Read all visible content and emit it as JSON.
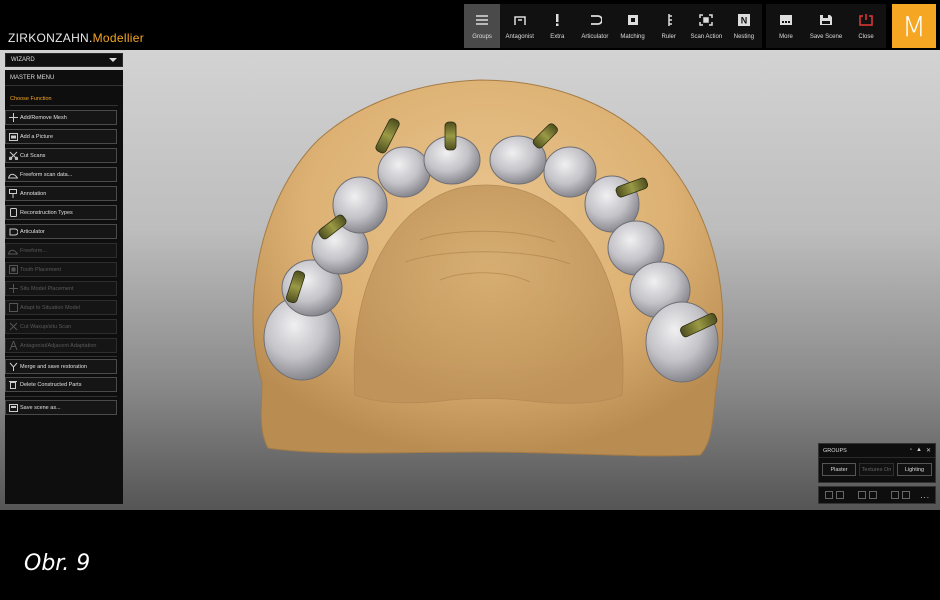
{
  "app": {
    "brand_main": "ZIRKONZAHN.",
    "brand_accent": "Modellier",
    "logo_letter": "M"
  },
  "toolbar": [
    {
      "label": "Groups",
      "icon": "groups-icon",
      "active": true
    },
    {
      "label": "Antagonist",
      "icon": "antagonist-icon"
    },
    {
      "label": "Extra",
      "icon": "extra-icon"
    },
    {
      "label": "Articulator",
      "icon": "articulator-icon"
    },
    {
      "label": "Matching",
      "icon": "matching-icon"
    },
    {
      "label": "Ruler",
      "icon": "ruler-icon"
    },
    {
      "label": "Scan Action",
      "icon": "scan-action-icon"
    },
    {
      "label": "Nesting",
      "icon": "nesting-icon"
    }
  ],
  "toolbar_right": [
    {
      "label": "More",
      "icon": "more-icon"
    },
    {
      "label": "Save Scene",
      "icon": "save-icon"
    },
    {
      "label": "Close",
      "icon": "close-icon"
    }
  ],
  "wizard": {
    "label": "WIZARD"
  },
  "panel": {
    "master_menu": "MASTER MENU",
    "choose_function": "Choose Function",
    "functions": [
      {
        "label": "Add/Remove Mesh",
        "icon": "add-remove-mesh-icon",
        "enabled": true
      },
      {
        "label": "Add a Picture",
        "icon": "picture-icon",
        "enabled": true
      },
      {
        "label": "Cut Scans",
        "icon": "scissors-icon",
        "enabled": true
      },
      {
        "label": "Freeform scan data...",
        "icon": "freeform-icon",
        "enabled": true
      },
      {
        "label": "Annotation",
        "icon": "annotation-icon",
        "enabled": true
      },
      {
        "label": "Reconstruction Types",
        "icon": "reconstruction-icon",
        "enabled": true
      },
      {
        "label": "Articulator",
        "icon": "articulator-icon",
        "enabled": true
      },
      {
        "label": "Freeform...",
        "icon": "freeform-icon",
        "enabled": false
      },
      {
        "label": "Tooth Placement",
        "icon": "tooth-placement-icon",
        "enabled": false
      },
      {
        "label": "Situ Model Placement",
        "icon": "move-icon",
        "enabled": false
      },
      {
        "label": "Adapt to Situation Model",
        "icon": "adapt-icon",
        "enabled": false
      },
      {
        "label": "Cut Waxup/situ Scan",
        "icon": "scissors-icon",
        "enabled": false
      },
      {
        "label": "Antagonist/Adjacent Adaptation",
        "icon": "antagonist-adapt-icon",
        "enabled": false
      }
    ],
    "merge": {
      "label": "Merge and save restoration",
      "icon": "merge-icon"
    },
    "delete": {
      "label": "Delete Constructed Parts",
      "icon": "trash-icon"
    },
    "save": {
      "label": "Save scene as...",
      "icon": "save-scene-icon"
    }
  },
  "groups_panel": {
    "title": "GROUPS",
    "buttons": [
      {
        "label": "Plaster",
        "enabled": true
      },
      {
        "label": "Textures On",
        "enabled": false
      },
      {
        "label": "Lighting",
        "enabled": true
      }
    ]
  },
  "layers": {
    "more": "..."
  },
  "caption": "Obr. 9",
  "colors": {
    "accent": "#f5a623",
    "plaster": "#e2b679",
    "tooth": "#c8c8cc",
    "implant": "#8a8a40",
    "close": "#e53935"
  }
}
